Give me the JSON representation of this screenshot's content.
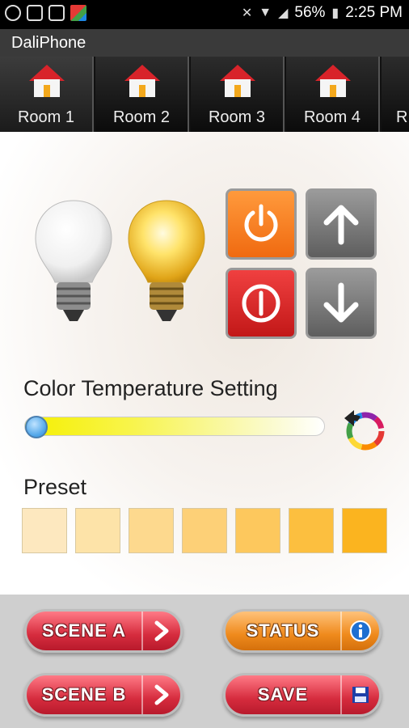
{
  "status_bar": {
    "left_icons": [
      "whatsapp-icon",
      "photo-icon",
      "screen-icon",
      "app-icon"
    ],
    "battery": "56%",
    "time": "2:25 PM"
  },
  "app": {
    "title": "DaliPhone"
  },
  "tabs": [
    {
      "label": "Room 1",
      "active": true
    },
    {
      "label": "Room 2"
    },
    {
      "label": "Room 3"
    },
    {
      "label": "Room 4"
    },
    {
      "label": "R"
    }
  ],
  "controls": {
    "bulbs": [
      "cool-bulb-icon",
      "warm-bulb-icon"
    ],
    "buttons": [
      "power-on-button",
      "brightness-up-button",
      "power-off-button",
      "brightness-down-button"
    ]
  },
  "color_temperature": {
    "label": "Color Temperature Setting",
    "value": 0
  },
  "preset": {
    "label": "Preset",
    "swatches": [
      "#fde8bf",
      "#fde3a8",
      "#fdd98e",
      "#fdd077",
      "#fdc85d",
      "#fcbf3f",
      "#fbb41f"
    ]
  },
  "bottom_buttons": {
    "scene_a": "SCENE A",
    "scene_b": "SCENE B",
    "status": "STATUS",
    "save": "SAVE"
  },
  "colors": {
    "accent_orange": "#f07d1c",
    "accent_red": "#d62c3e"
  }
}
